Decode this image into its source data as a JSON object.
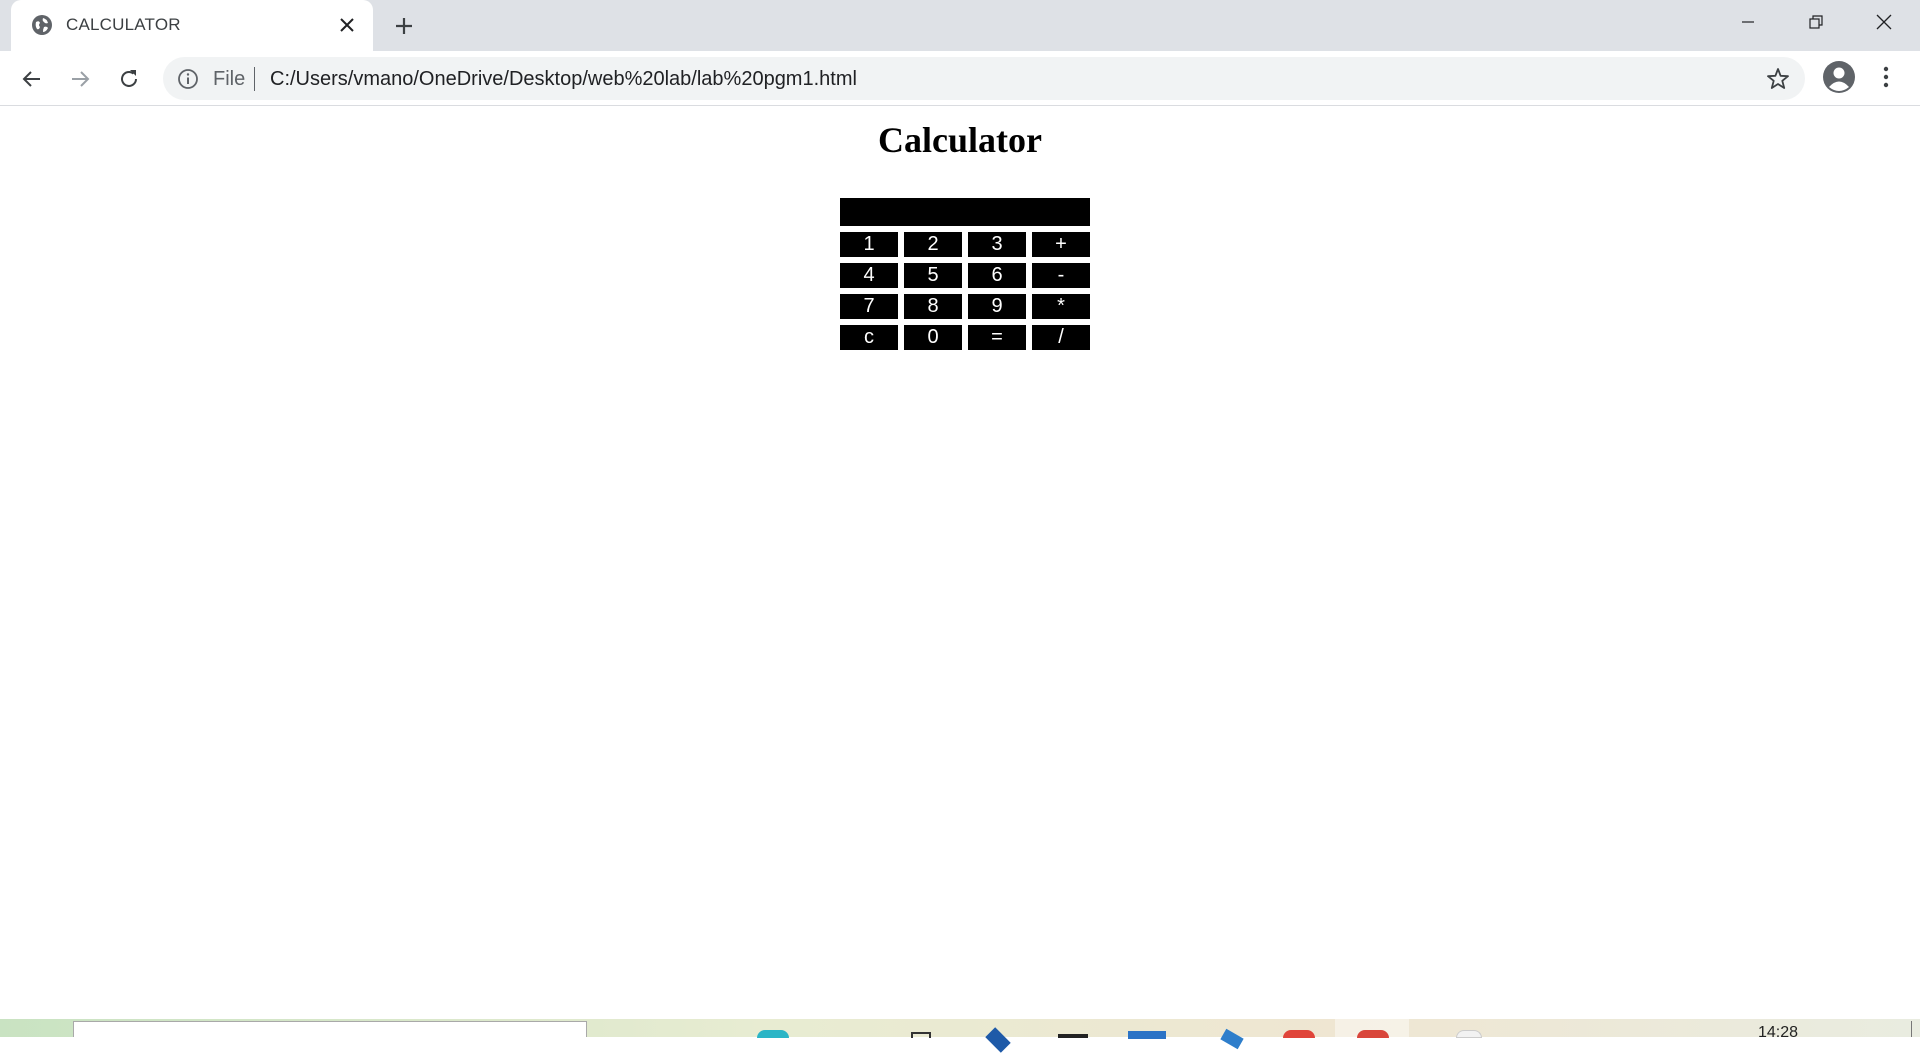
{
  "browser": {
    "tab": {
      "title": "CALCULATOR",
      "favicon": "globe-icon"
    },
    "new_tab": "plus-icon",
    "window_controls": [
      "minimize-icon",
      "restore-icon",
      "close-icon"
    ],
    "toolbar": {
      "back": "arrow-left-icon",
      "forward": "arrow-right-icon",
      "reload": "reload-icon"
    },
    "omnibox": {
      "scheme_label": "File",
      "url": "C:/Users/vmano/OneDrive/Desktop/web%20lab/lab%20pgm1.html",
      "info_icon": "info-icon",
      "bookmark_icon": "star-icon"
    },
    "profile_icon": "account-icon",
    "menu_icon": "kebab-menu-icon"
  },
  "page": {
    "title": "Calculator",
    "display_value": "",
    "keys": [
      [
        "1",
        "2",
        "3",
        "+"
      ],
      [
        "4",
        "5",
        "6",
        "-"
      ],
      [
        "7",
        "8",
        "9",
        "*"
      ],
      [
        "c",
        "0",
        "=",
        "/"
      ]
    ],
    "colors": {
      "key_background": "#000000",
      "key_text": "#ffffff"
    }
  },
  "taskbar": {
    "clock": "14:28"
  }
}
